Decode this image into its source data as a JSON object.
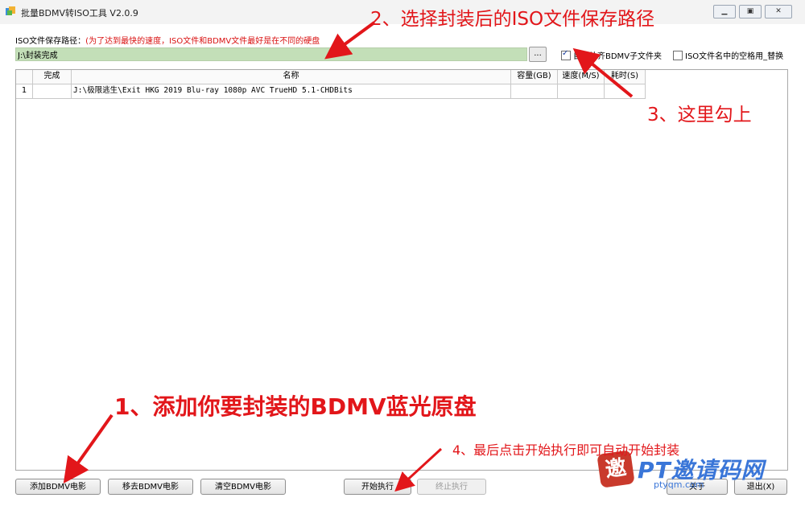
{
  "window": {
    "title": "批量BDMV转ISO工具 V2.0.9",
    "buttons": [
      "▁",
      "▣",
      "✕"
    ]
  },
  "output": {
    "label": "ISO文件保存路径：",
    "hint": "(为了达到最快的速度，ISO文件和BDMV文件最好是在不同的硬盘",
    "path_value": "J:\\封装完成",
    "browse_label": "..."
  },
  "options": {
    "auto_bdmv_folder": {
      "label": "自动补齐BDMV子文件夹",
      "checked": true
    },
    "replace_spaces": {
      "label": "ISO文件名中的空格用_替换",
      "checked": false
    }
  },
  "table": {
    "columns": [
      "",
      "完成",
      "名称",
      "容量(GB)",
      "速度(M/S)",
      "耗时(S)"
    ],
    "rows": [
      {
        "index": "1",
        "done": "",
        "name": "J:\\极限逃生\\Exit HKG 2019 Blu-ray 1080p AVC TrueHD 5.1-CHDBits",
        "size": "",
        "speed": "",
        "time": ""
      }
    ]
  },
  "buttons": {
    "add": "添加BDMV电影",
    "remove": "移去BDMV电影",
    "clear": "清空BDMV电影",
    "start": "开始执行",
    "stop": "终止执行",
    "about": "关于",
    "exit": "退出(X)"
  },
  "annotations": {
    "step1": "1、添加你要封装的BDMV蓝光原盘",
    "step2": "2、选择封装后的ISO文件保存路径",
    "step3": "3、这里勾上",
    "step4": "4、最后点击开始执行即可自动开始封装"
  },
  "watermark": {
    "logo_char": "邀",
    "name": "PT邀请码网",
    "url": "ptyqm.com"
  },
  "colors": {
    "annotation": "#e2161a",
    "path_field": "#c3dfb8",
    "hint": "#d91111",
    "watermark": "#3a76d8"
  }
}
